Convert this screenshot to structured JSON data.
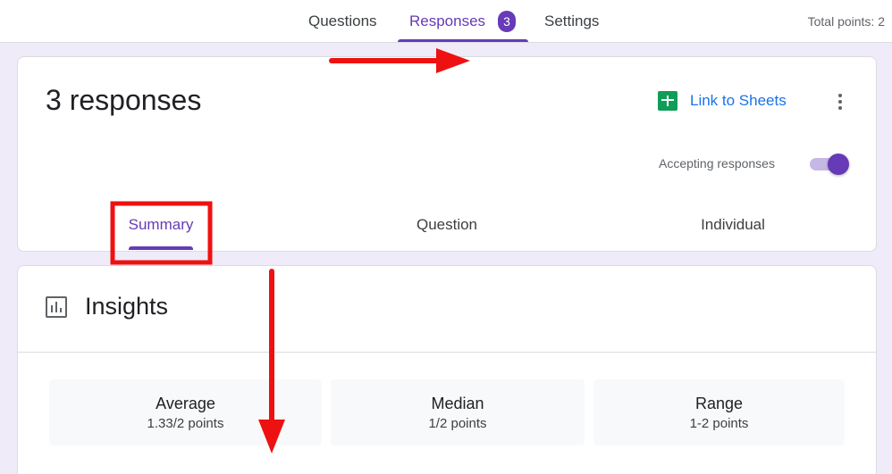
{
  "header": {
    "tabs": [
      {
        "label": "Questions"
      },
      {
        "label": "Responses",
        "badge": "3"
      },
      {
        "label": "Settings"
      }
    ],
    "total_points": "Total points: 2"
  },
  "responses": {
    "title": "3 responses",
    "link_to_sheets": "Link to Sheets",
    "accepting_label": "Accepting responses",
    "accepting": true,
    "subtabs": [
      {
        "label": "Summary"
      },
      {
        "label": "Question"
      },
      {
        "label": "Individual"
      }
    ]
  },
  "insights": {
    "title": "Insights",
    "stats": [
      {
        "label": "Average",
        "value": "1.33/2 points"
      },
      {
        "label": "Median",
        "value": "1/2 points"
      },
      {
        "label": "Range",
        "value": "1-2 points"
      }
    ]
  },
  "colors": {
    "accent": "#673ab7",
    "annotation": "#ee1111",
    "link": "#1a73e8",
    "sheets": "#0f9d58"
  },
  "icons": [
    "google-sheets-icon",
    "more-vert-icon",
    "insights-chart-icon"
  ]
}
